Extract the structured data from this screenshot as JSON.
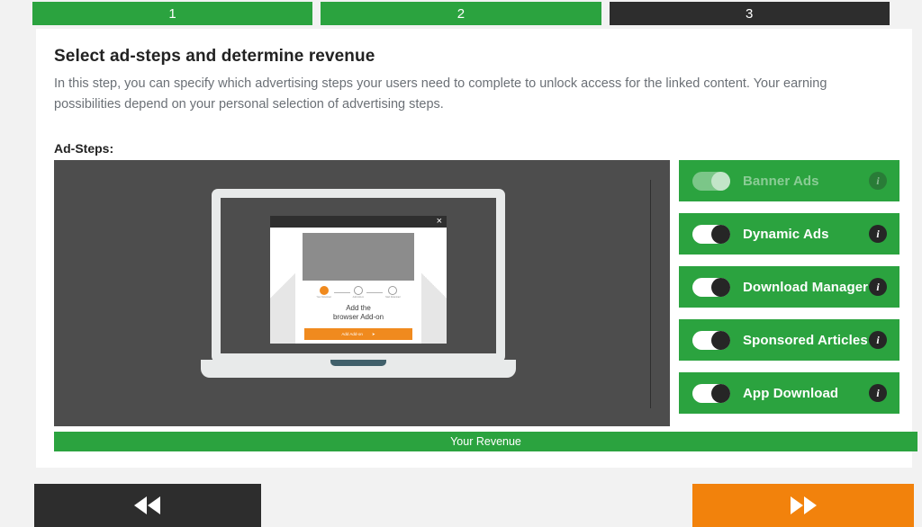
{
  "progress": {
    "steps": [
      {
        "label": "1",
        "state": "done"
      },
      {
        "label": "2",
        "state": "done"
      },
      {
        "label": "3",
        "state": "active"
      }
    ]
  },
  "card": {
    "title": "Select ad-steps and determine revenue",
    "description": "In this step, you can specify which advertising steps your users need to complete to unlock access for the linked content. Your earning possibilities depend on your personal selection of advertising steps.",
    "adsteps_label": "Ad-Steps:"
  },
  "preview": {
    "modal": {
      "close_label": "×",
      "stepper": [
        {
          "caption": "Your Download"
        },
        {
          "caption": "Add Add-on"
        },
        {
          "caption": "Start Download"
        }
      ],
      "heading_line1": "Add the",
      "heading_line2": "browser Add-on",
      "cta_label": "Add Add-on",
      "cta_arrow": "➤"
    }
  },
  "revenue": {
    "label": "Your Revenue"
  },
  "adsteps": [
    {
      "label": "Banner Ads",
      "enabled": true,
      "disabled_row": true,
      "info": "i"
    },
    {
      "label": "Dynamic Ads",
      "enabled": true,
      "disabled_row": false,
      "info": "i"
    },
    {
      "label": "Download Manager",
      "enabled": true,
      "disabled_row": false,
      "info": "i"
    },
    {
      "label": "Sponsored Articles",
      "enabled": true,
      "disabled_row": false,
      "info": "i"
    },
    {
      "label": "App Download",
      "enabled": true,
      "disabled_row": false,
      "info": "i"
    }
  ],
  "nav": {
    "prev_icon": "rewind-icon",
    "next_icon": "fast-forward-icon"
  },
  "colors": {
    "green": "#2ba33f",
    "dark": "#2d2d2d",
    "orange": "#f2820c",
    "panel": "#4d4d4d"
  }
}
